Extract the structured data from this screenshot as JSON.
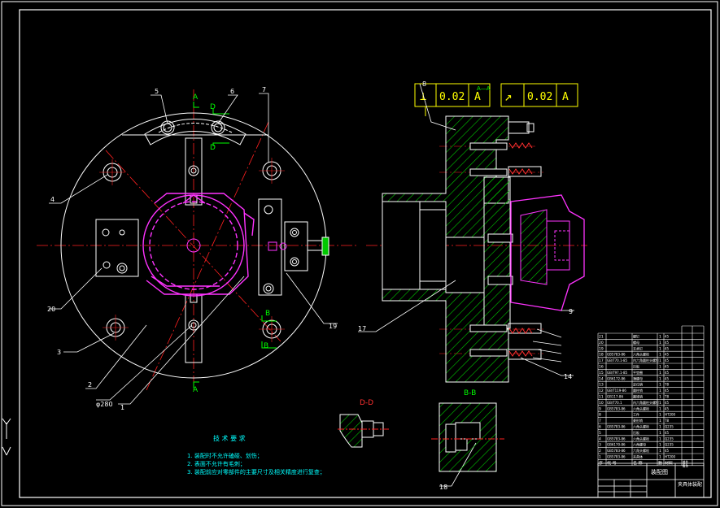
{
  "colors": {
    "background": "#000000",
    "line": "#ffffff",
    "center": "#ff2020",
    "part": "#ff33ff",
    "hatch": "#00c800",
    "leader": "#ffffff",
    "label": "#00ffff",
    "title_yellow": "#ffff00",
    "section_red": "#ff3030"
  },
  "plan_view": {
    "labels": {
      "l5": "5",
      "l6": "6",
      "l7": "7",
      "l4": "4",
      "l20": "20",
      "l3": "3",
      "l2": "2",
      "l21": "φ280",
      "l1": "1",
      "l19": "19"
    },
    "section_marks": {
      "a_top": "A",
      "a_bottom": "A",
      "d_top": "D",
      "d_bottom": "D",
      "b_top": "B",
      "b_bottom": "B"
    }
  },
  "section_view": {
    "labels": {
      "l8": "8",
      "l17": "17",
      "l9": "9",
      "l14": "14",
      "l18": "18"
    },
    "tolerance_left": {
      "symbol": "⊥",
      "value": "0.02",
      "datum": "A",
      "note": "A—A"
    },
    "tolerance_right": {
      "symbol": "↗",
      "value": "0.02",
      "datum": "A"
    },
    "title_bb": "B-B",
    "title_dd": "D-D"
  },
  "notes": {
    "heading": "技 术 要 求",
    "items": [
      "1. 装配时不允许磕碰、划伤；",
      "2. 表面不允许有毛刺；",
      "3. 装配前应对零部件的主要尺寸及相关精度进行复查；"
    ]
  },
  "bom": {
    "rows": [
      [
        "21",
        "",
        "螺钉",
        "1",
        "45"
      ],
      [
        "20",
        "",
        "螺母",
        "1",
        "45"
      ],
      [
        "19",
        "",
        "支承钉",
        "1",
        "45"
      ],
      [
        "18",
        "GB5783-86",
        "六角头螺栓",
        "1",
        "45"
      ],
      [
        "17",
        "GB/T70.1-85",
        "内六角圆柱头螺钉",
        "1",
        "45"
      ],
      [
        "16",
        "",
        "压板",
        "1",
        "45"
      ],
      [
        "15",
        "GB/T97.1-85",
        "平垫圈",
        "1",
        "45"
      ],
      [
        "14",
        "GB6172-86",
        "薄螺母",
        "1",
        "45"
      ],
      [
        "13",
        "",
        "定位销",
        "1",
        "T8"
      ],
      [
        "12",
        "GB/T119-86",
        "圆柱销",
        "1",
        "45"
      ],
      [
        "11",
        "GB117-86",
        "圆锥销",
        "1",
        "T8"
      ],
      [
        "10",
        "GB/T70.1",
        "内六角圆柱头螺钉",
        "1",
        "45"
      ],
      [
        "9",
        "GB5783-86",
        "六角头螺栓",
        "1",
        "45"
      ],
      [
        "8",
        "",
        "工件",
        "1",
        "HT200"
      ],
      [
        "7",
        "",
        "菱形销",
        "1",
        "T8"
      ],
      [
        "6",
        "GB5783-86",
        "六角头螺栓",
        "1",
        "Q235"
      ],
      [
        "5",
        "",
        "压板",
        "1",
        "45"
      ],
      [
        "4",
        "GB5783-86",
        "六角头螺栓",
        "1",
        "Q235"
      ],
      [
        "3",
        "GB6170-86",
        "六角螺母",
        "1",
        "Q235"
      ],
      [
        "2",
        "GB5783-86",
        "六角头螺栓",
        "1",
        "45"
      ],
      [
        "1",
        "GB5783-86",
        "夹具体",
        "1",
        "HT200"
      ]
    ],
    "header": [
      "序",
      "代 号",
      "名 称",
      "数",
      "材料"
    ],
    "header_extra": [
      "单件",
      "总计",
      "备注"
    ],
    "title_block": {
      "drawing_name": "装配图",
      "note": "夹具体装配"
    }
  }
}
